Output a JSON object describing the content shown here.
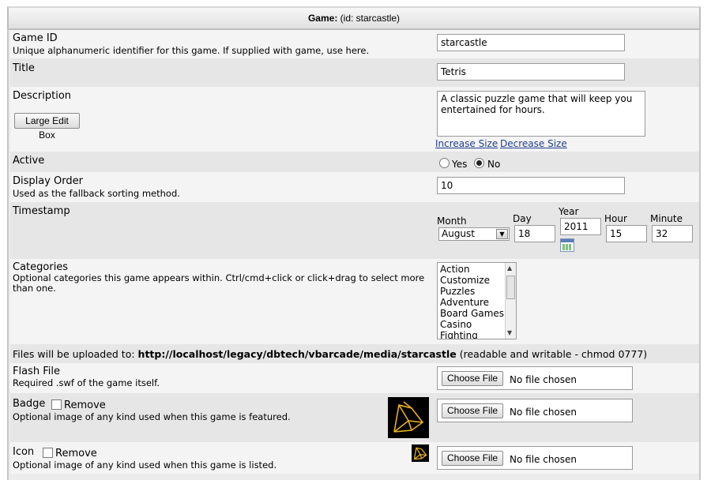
{
  "header": {
    "title_bold": "Game:",
    "title_rest": "(id: starcastle)"
  },
  "game_id": {
    "label": "Game ID",
    "description": "Unique alphanumeric identifier for this game. If supplied with game, use here.",
    "value": "starcastle"
  },
  "title": {
    "label": "Title",
    "value": "Tetris"
  },
  "description": {
    "label": "Description",
    "large_edit_label": "Large Edit Box",
    "value": "A classic puzzle game that will keep you entertained for hours.",
    "increase_label": "Increase Size",
    "decrease_label": "Decrease Size"
  },
  "active": {
    "label": "Active",
    "yes_label": "Yes",
    "no_label": "No",
    "selected": "No"
  },
  "display_order": {
    "label": "Display Order",
    "description": "Used as the fallback sorting method.",
    "value": "10"
  },
  "timestamp": {
    "label": "Timestamp",
    "month_label": "Month",
    "month_value": "August",
    "day_label": "Day",
    "day_value": "18",
    "year_label": "Year",
    "year_value": "2011",
    "hour_label": "Hour",
    "hour_value": "15",
    "minute_label": "Minute",
    "minute_value": "32"
  },
  "categories": {
    "label": "Categories",
    "description": "Optional categories this game appears within. Ctrl/cmd+click or click+drag to select more than one.",
    "items": [
      "Action",
      "Customize",
      "Puzzles",
      "Adventure",
      "Board Games",
      "Casino",
      "Fighting"
    ]
  },
  "upload_note": {
    "prefix": "Files will be uploaded to:",
    "path": "http://localhost/legacy/dbtech/vbarcade/media/starcastle",
    "suffix": "(readable and writable - chmod 0777)"
  },
  "flash_file": {
    "label": "Flash File",
    "description": "Required .swf of the game itself.",
    "button": "Choose File",
    "status": "No file chosen"
  },
  "badge": {
    "label": "Badge",
    "remove_label": "Remove",
    "description": "Optional image of any kind used when this game is featured.",
    "button": "Choose File",
    "status": "No file chosen"
  },
  "icon": {
    "label": "Icon",
    "remove_label": "Remove",
    "description": "Optional image of any kind used when this game is listed.",
    "button": "Choose File",
    "status": "No file chosen"
  },
  "colors": {
    "link": "#1f3f8f",
    "row_light": "#f4f4f4",
    "row_dark": "#e6e6e6"
  }
}
